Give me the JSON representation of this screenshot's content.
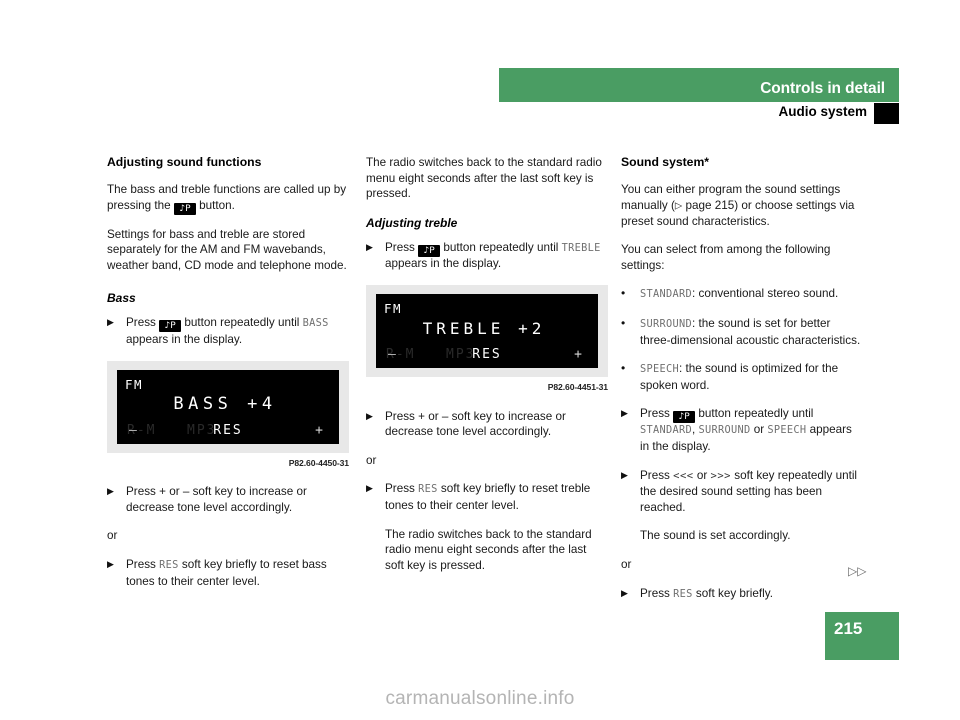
{
  "header": {
    "chapter_title": "Controls in detail",
    "section_title": "Audio system"
  },
  "page_number": "215",
  "continuation_marker": "▷▷",
  "watermark": "carmanualsonline.info",
  "icons": {
    "sound_button_glyph": "♪P",
    "step_arrow": "▶",
    "bullet": "•",
    "ref_triangle": "▷"
  },
  "col1": {
    "title": "Adjusting sound functions",
    "p1_before": "The bass and treble functions are called up by pressing the",
    "p1_after": "button.",
    "p2": "Settings for bass and treble are stored separately for the AM and FM wavebands, weather band, CD mode and telephone mode.",
    "subtitle_bass": "Bass",
    "step1_before": "Press",
    "step1_mid": "button repeatedly until",
    "step1_term": "BASS",
    "step1_after": "appears in the display.",
    "figure": {
      "band": "FM",
      "main": "BASS  +4",
      "softkey_left": "–",
      "softkey_center": "RES",
      "softkey_right": "+",
      "ghost_left": "R-M",
      "ghost_mid": "MP3",
      "caption": "P82.60-4450-31"
    },
    "step2": "Press + or – soft key to increase or decrease tone level accordingly.",
    "or": "or",
    "step3_before": "Press",
    "step3_term": "RES",
    "step3_after": "soft key briefly to reset bass tones to their center level."
  },
  "col2": {
    "p1": "The radio switches back to the standard radio menu eight seconds after the last soft key is pressed.",
    "subtitle_treble": "Adjusting treble",
    "step1_before": "Press",
    "step1_mid": "button repeatedly until",
    "step1_term": "TREBLE",
    "step1_after": "appears in the display.",
    "figure": {
      "band": "FM",
      "main": "TREBLE  +2",
      "softkey_left": "–",
      "softkey_center": "RES",
      "softkey_right": "+",
      "ghost_left": "R-M",
      "ghost_mid": "MP3",
      "caption": "P82.60-4451-31"
    },
    "step2": "Press + or – soft key to increase or decrease tone level accordingly.",
    "or": "or",
    "step3_before": "Press",
    "step3_term": "RES",
    "step3_after": "soft key briefly to reset treble tones to their center level.",
    "p2": "The radio switches back to the standard radio menu eight seconds after the last soft key is pressed."
  },
  "col3": {
    "title": "Sound system*",
    "p1_a": "You can either program the sound settings manually (",
    "p1_ref": "page 215",
    "p1_b": ") or choose settings via preset sound characteristics.",
    "p2": "You can select from among the following settings:",
    "bullets": [
      {
        "term": "STANDARD",
        "text": ": conventional stereo sound."
      },
      {
        "term": "SURROUND",
        "text": ": the sound is set for better three-dimensional acoustic characteristics."
      },
      {
        "term": "SPEECH",
        "text": ": the sound is optimized for the spoken word."
      }
    ],
    "step1_before": "Press",
    "step1_mid": "button repeatedly until",
    "step1_term1": "STANDARD",
    "step1_comma": ",",
    "step1_term2": "SURROUND",
    "step1_or": "or",
    "step1_term3": "SPEECH",
    "step1_after": "appears in the display.",
    "step2_before": "Press",
    "step2_arrows_left": "<<<",
    "step2_or": "or",
    "step2_arrows_right": ">>>",
    "step2_after": "soft key repeatedly until the desired sound setting has been reached.",
    "step2_note": "The sound is set accordingly.",
    "or": "or",
    "step3_before": "Press",
    "step3_term": "RES",
    "step3_after": "soft key briefly."
  },
  "colors": {
    "accent_green": "#4a9d63",
    "display_bg": "#000000",
    "display_frame": "#e8e8e8",
    "mono_term": "#707070"
  }
}
